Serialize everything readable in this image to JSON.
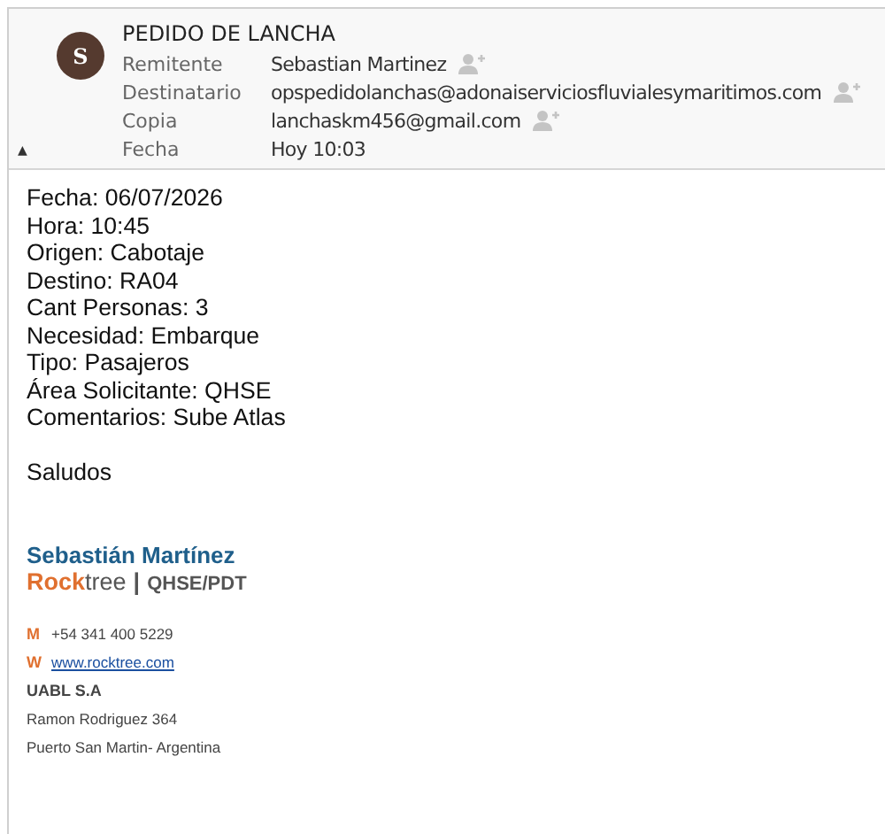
{
  "header": {
    "avatar_letter": "S",
    "subject": "PEDIDO DE LANCHA",
    "fields": [
      {
        "label": "Remitente",
        "value": "Sebastian Martinez",
        "add_contact": true
      },
      {
        "label": "Destinatario",
        "value": "opspedidolanchas@adonaiserviciosfluvialesymaritimos.com",
        "add_contact": true
      },
      {
        "label": "Copia",
        "value": "lanchaskm456@gmail.com",
        "add_contact": true
      },
      {
        "label": "Fecha",
        "value": "Hoy 10:03",
        "add_contact": false
      }
    ],
    "collapse_glyph": "▲"
  },
  "body": {
    "lines": [
      "Fecha: 06/07/2026",
      "Hora: 10:45",
      "Origen: Cabotaje",
      "Destino: RA04",
      "Cant Personas: 3",
      "Necesidad: Embarque",
      "Tipo: Pasajeros",
      "Área Solicitante: QHSE",
      "Comentarios: Sube Atlas"
    ],
    "closing": "Saludos"
  },
  "signature": {
    "name": "Sebastián Martínez",
    "brand": "**Rock**tree",
    "separator": "|",
    "department": "QHSE/PDT",
    "contacts": [
      {
        "letter": "M",
        "text": "+54 341 400 5229",
        "kind": "text"
      },
      {
        "letter": "W",
        "text": "www.rocktree.com",
        "kind": "link"
      }
    ],
    "company": "UABL S.A",
    "address": [
      "Ramon Rodriguez 364",
      "Puerto San Martin- Argentina"
    ]
  }
}
